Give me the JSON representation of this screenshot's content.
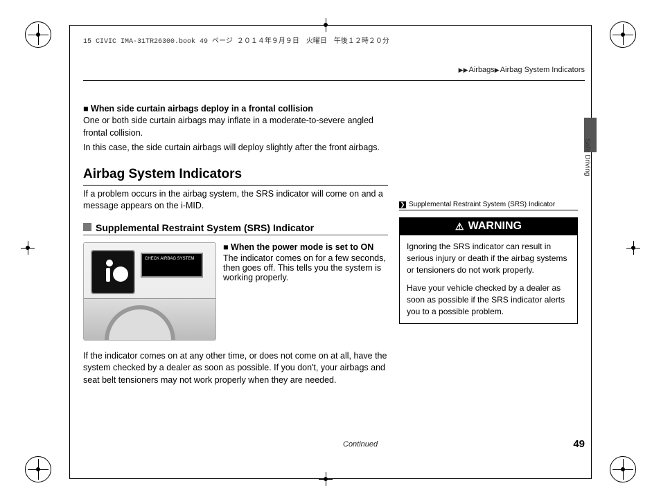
{
  "header": {
    "book_info": "15 CIVIC IMA-31TR26300.book  49 ページ  ２０１４年９月９日　火曜日　午後１２時２０分"
  },
  "breadcrumb": {
    "a": "Airbags",
    "b": "Airbag System Indicators"
  },
  "section_tab": "Safe Driving",
  "sub1": {
    "title": "■ When side curtain airbags deploy in a frontal collision",
    "p1": "One or both side curtain airbags may inflate in a moderate-to-severe angled frontal collision.",
    "p2": "In this case, the side curtain airbags will deploy slightly after the front airbags."
  },
  "h2": "Airbag System Indicators",
  "h2_body": "If a problem occurs in the airbag system, the SRS indicator will come on and a message appears on the i-MID.",
  "srs": {
    "title": "Supplemental Restraint System (SRS) Indicator",
    "lcd_text": "CHECK AIRBAG SYSTEM",
    "pm_title": "■ When the power mode is set to ON",
    "pm_body": "The indicator comes on for a few seconds, then goes off. This tells you the system is working properly."
  },
  "after": "If the indicator comes on at any other time, or does not come on at all, have the system checked by a dealer as soon as possible. If you don't, your airbags and seat belt tensioners may not work properly when they are needed.",
  "side": {
    "ref": "Supplemental Restraint System (SRS) Indicator",
    "warn_title": "WARNING",
    "warn_p1": "Ignoring the SRS indicator can result in serious injury or death if the airbag systems or tensioners do not work properly.",
    "warn_p2": "Have your vehicle checked by a dealer as soon as possible if the SRS indicator alerts you to a possible problem."
  },
  "footer": {
    "continued": "Continued",
    "page": "49"
  }
}
